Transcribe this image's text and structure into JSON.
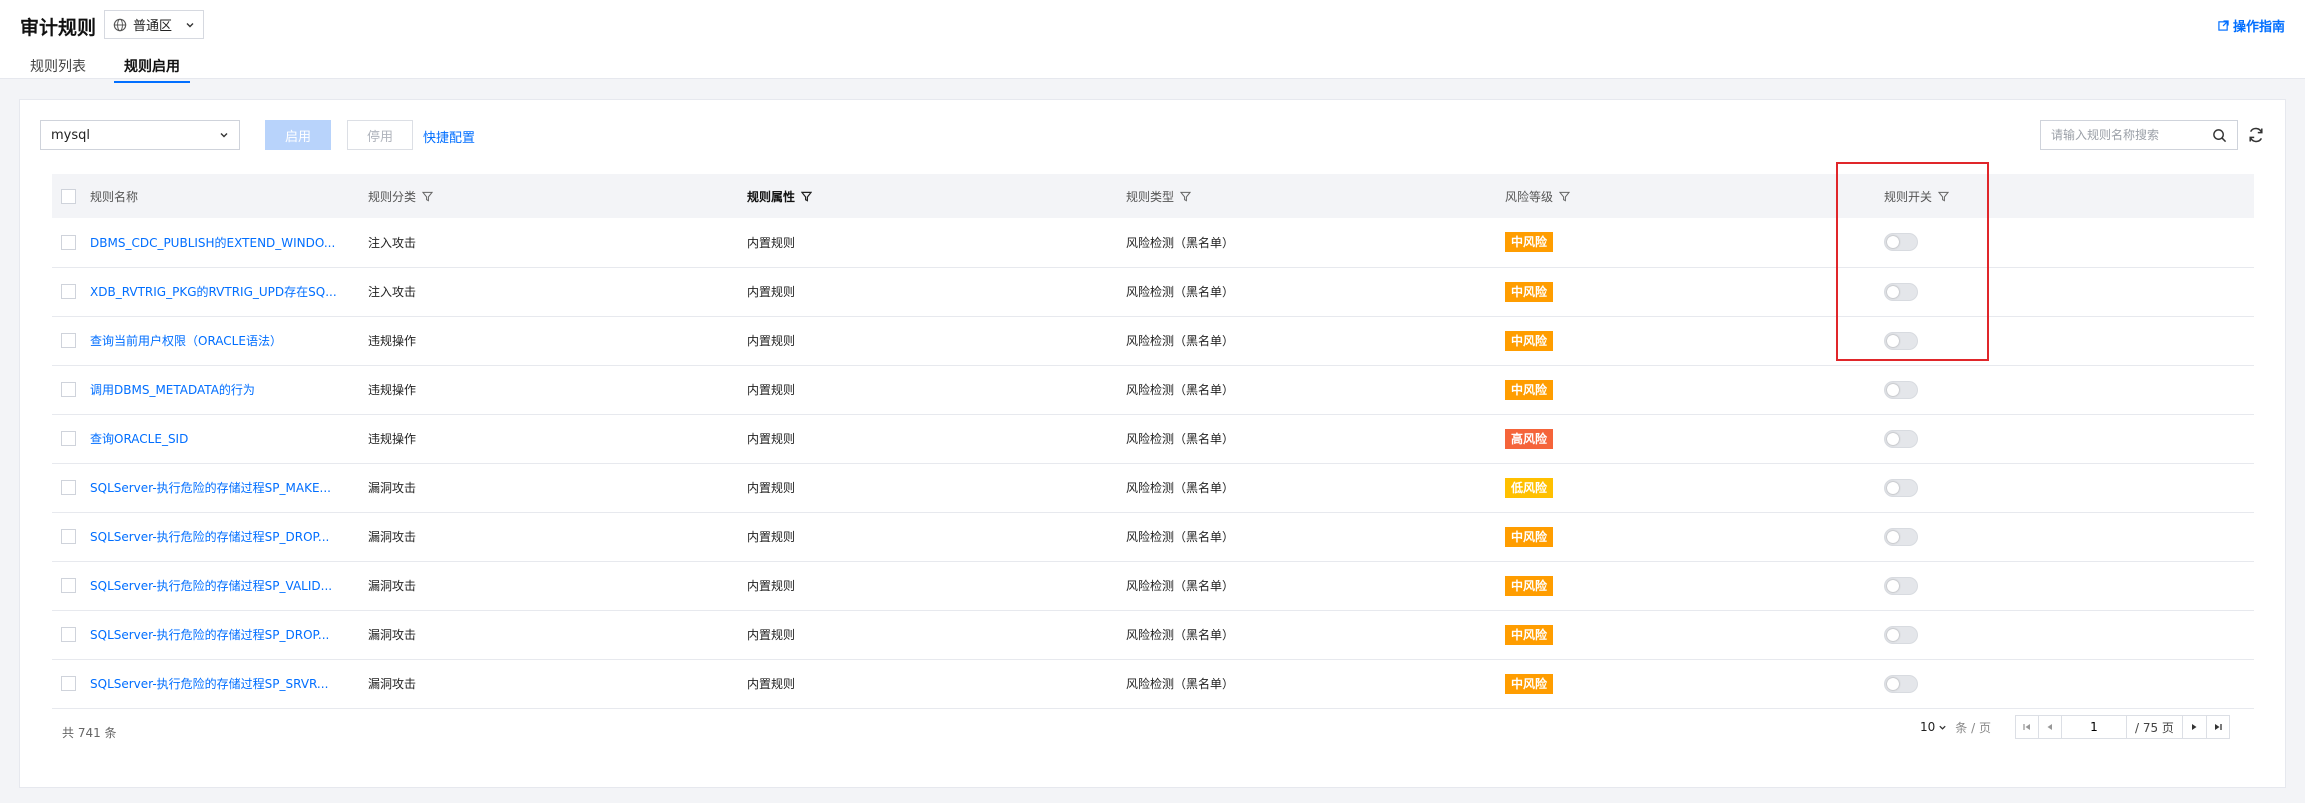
{
  "header": {
    "title": "审计规则",
    "region": "普通区",
    "guide_link": "操作指南"
  },
  "tabs": [
    {
      "label": "规则列表",
      "active": false
    },
    {
      "label": "规则启用",
      "active": true
    }
  ],
  "toolbar": {
    "db_select": "mysql",
    "enable_label": "启用",
    "disable_label": "停用",
    "quick_config": "快捷配置",
    "search_placeholder": "请输入规则名称搜索"
  },
  "table": {
    "columns": [
      "规则名称",
      "规则分类",
      "规则属性",
      "规则类型",
      "风险等级",
      "规则开关"
    ],
    "rows": [
      {
        "name": "DBMS_CDC_PUBLISH的EXTEND_WINDO...",
        "category": "注入攻击",
        "attr": "内置规则",
        "type": "风险检测（黑名单）",
        "risk": "中风险",
        "enabled": false
      },
      {
        "name": "XDB_RVTRIG_PKG的RVTRIG_UPD存在SQ...",
        "category": "注入攻击",
        "attr": "内置规则",
        "type": "风险检测（黑名单）",
        "risk": "中风险",
        "enabled": false
      },
      {
        "name": "查询当前用户权限（ORACLE语法）",
        "category": "违规操作",
        "attr": "内置规则",
        "type": "风险检测（黑名单）",
        "risk": "中风险",
        "enabled": false
      },
      {
        "name": "调用DBMS_METADATA的行为",
        "category": "违规操作",
        "attr": "内置规则",
        "type": "风险检测（黑名单）",
        "risk": "中风险",
        "enabled": false
      },
      {
        "name": "查询ORACLE_SID",
        "category": "违规操作",
        "attr": "内置规则",
        "type": "风险检测（黑名单）",
        "risk": "高风险",
        "enabled": false
      },
      {
        "name": "SQLServer-执行危险的存储过程SP_MAKE...",
        "category": "漏洞攻击",
        "attr": "内置规则",
        "type": "风险检测（黑名单）",
        "risk": "低风险",
        "enabled": false
      },
      {
        "name": "SQLServer-执行危险的存储过程SP_DROP...",
        "category": "漏洞攻击",
        "attr": "内置规则",
        "type": "风险检测（黑名单）",
        "risk": "中风险",
        "enabled": false
      },
      {
        "name": "SQLServer-执行危险的存储过程SP_VALID...",
        "category": "漏洞攻击",
        "attr": "内置规则",
        "type": "风险检测（黑名单）",
        "risk": "中风险",
        "enabled": false
      },
      {
        "name": "SQLServer-执行危险的存储过程SP_DROP...",
        "category": "漏洞攻击",
        "attr": "内置规则",
        "type": "风险检测（黑名单）",
        "risk": "中风险",
        "enabled": false
      },
      {
        "name": "SQLServer-执行危险的存储过程SP_SRVR...",
        "category": "漏洞攻击",
        "attr": "内置规则",
        "type": "风险检测（黑名单）",
        "risk": "中风险",
        "enabled": false
      }
    ]
  },
  "risk_colors": {
    "中风险": "#ff9d00",
    "高风险": "#f5643a",
    "低风险": "#ffc000"
  },
  "footer": {
    "total": "共 741 条",
    "page_size": "10",
    "page_size_unit": "条 / 页",
    "current_page": "1",
    "page_total": "/ 75 页"
  },
  "colors": {
    "accent": "#006eff",
    "highlight": "#e0262a"
  }
}
